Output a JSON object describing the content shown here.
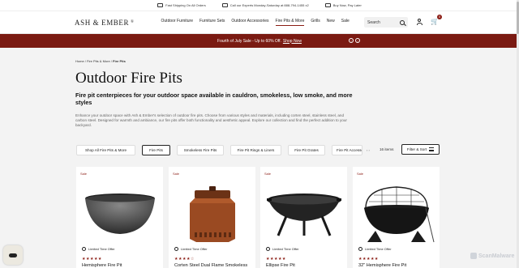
{
  "utility_bar": {
    "items": [
      {
        "icon": "truck-icon",
        "label": "Fast Shipping On All Orders"
      },
      {
        "icon": "phone-icon",
        "label": "Call our Experts Monday-Saturday at 888-794-1455 x2"
      },
      {
        "icon": "card-icon",
        "label": "Buy Now, Pay Later"
      }
    ]
  },
  "header": {
    "logo_text": "ASH & EMBER",
    "logo_mark": "®",
    "nav": [
      "Outdoor Furniture",
      "Furniture Sets",
      "Outdoor Accessories",
      "Fire Pits & More",
      "Grills",
      "New",
      "Sale"
    ],
    "active_nav": "Fire Pits & More",
    "search_placeholder": "Search",
    "cart_count": "0"
  },
  "promo": {
    "text": "Fourth of July Sale - Up to 60% Off.",
    "link": "Shop Now",
    "prev": "‹",
    "next": "›"
  },
  "breadcrumb": {
    "home": "Home",
    "sep": " / ",
    "parent": "Fire Pits & More",
    "current": "Fire Pits"
  },
  "page": {
    "title": "Outdoor Fire Pits",
    "subtitle": "Fire pit centerpieces for your outdoor space available in cauldron, smokeless, low smoke, and more styles",
    "description": "Enhance your outdoor space with Ash & Ember's selection of outdoor fire pits. Choose from various styles and materials, including corten steel, stainless steel, and carbon steel. Designed for warmth and ambiance, our fire pits offer both functionality and aesthetic appeal. Explore our collection and find the perfect addition to your backyard."
  },
  "filters": {
    "chips": [
      "Shop All Fire Pits & More",
      "Fire Pits",
      "Smokeless Fire Pits",
      "Fire Pit Rings & Liners",
      "Fire Pit Grates",
      "Fire Pit Accessories"
    ],
    "active": "Fire Pits",
    "pager": "‹ ›",
    "count": "16 items",
    "sort_label": "Filter & Sort"
  },
  "products": [
    {
      "badge": "Sale",
      "offer": "Limited Time Offer",
      "stars": "★★★★★",
      "name": "Hemisphere Fire Pit"
    },
    {
      "badge": "Sale",
      "offer": "Limited Time Offer",
      "stars": "★★★★☆",
      "name": "Corten Steel Dual Flame Smokeless"
    },
    {
      "badge": "Sale",
      "offer": "Limited Time Offer",
      "stars": "★★★★★",
      "name": "Ellipse Fire Pit"
    },
    {
      "badge": "Sale",
      "offer": "Limited Time Offer",
      "stars": "★★★★★",
      "name": "32\" Hemisphere Fire Pit"
    }
  ],
  "watermark": "ScanMalware",
  "colors": {
    "brand": "#7a1a12",
    "accent": "#8b1c14"
  }
}
